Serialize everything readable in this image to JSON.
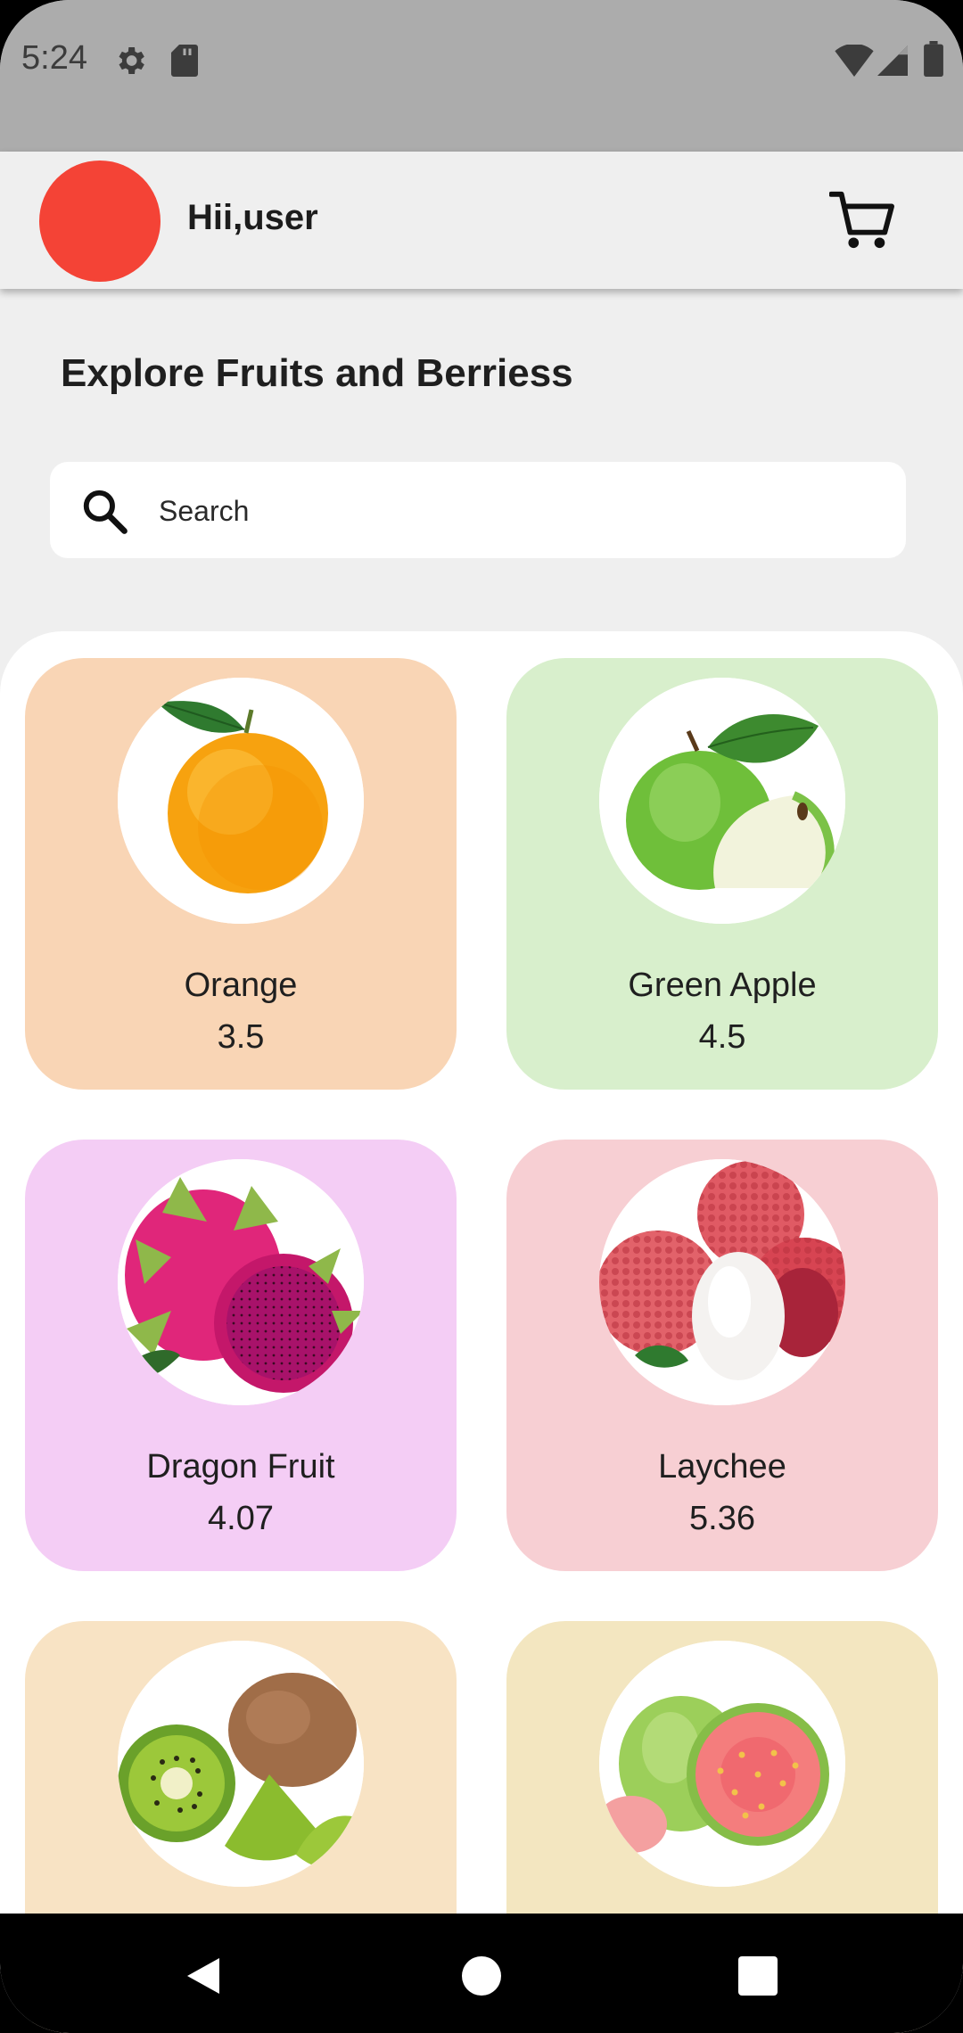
{
  "status_bar": {
    "time": "5:24",
    "icons": [
      "gear-icon",
      "sd-card-icon",
      "wifi-icon",
      "signal-icon",
      "battery-icon"
    ]
  },
  "app_bar": {
    "greeting": "Hii,user",
    "avatar_color": "#f44336",
    "cart_icon": "cart-icon"
  },
  "page": {
    "title": "Explore Fruits and Berriess"
  },
  "search": {
    "placeholder": "Search",
    "icon": "search-icon"
  },
  "products": [
    {
      "name": "Orange",
      "rating": "3.5",
      "card_color": "#f9d5b5",
      "image": "orange-image"
    },
    {
      "name": "Green Apple",
      "rating": "4.5",
      "card_color": "#d8efcc",
      "image": "green-apple-image"
    },
    {
      "name": "Dragon Fruit",
      "rating": "4.07",
      "card_color": "#f4cdf5",
      "image": "dragon-fruit-image"
    },
    {
      "name": "Laychee",
      "rating": "5.36",
      "card_color": "#f7cfd3",
      "image": "lychee-image"
    },
    {
      "name": "",
      "rating": "",
      "card_color": "#f8e3c4",
      "image": "kiwi-image"
    },
    {
      "name": "",
      "rating": "",
      "card_color": "#f3e6c0",
      "image": "guava-image"
    }
  ],
  "nav_bar": {
    "icons": [
      "back-icon",
      "home-icon",
      "recents-icon"
    ]
  }
}
